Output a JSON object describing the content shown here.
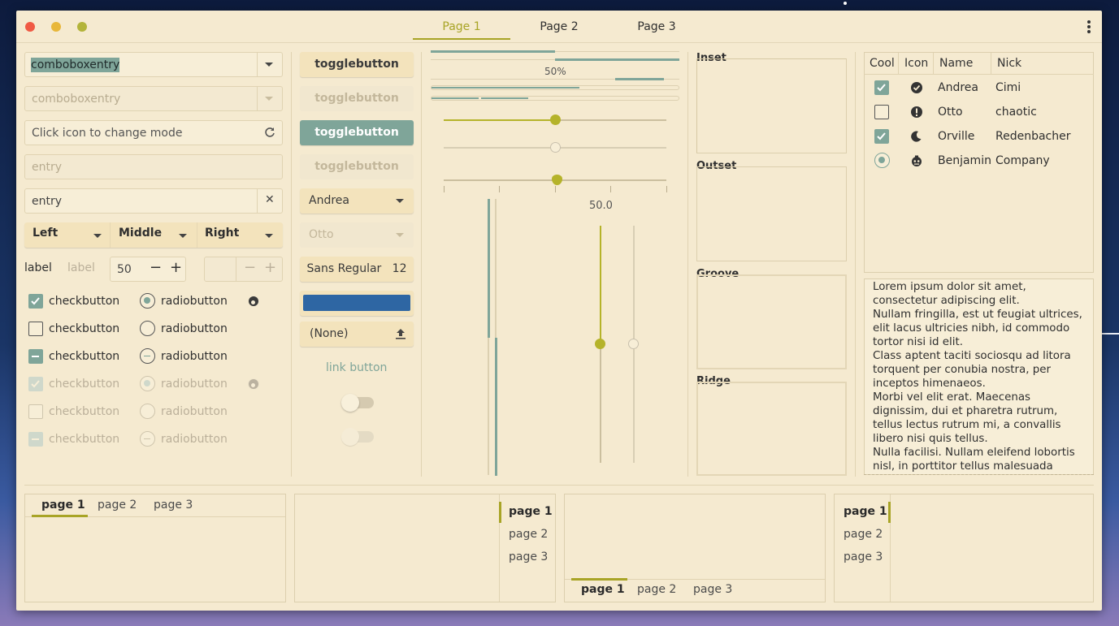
{
  "header": {
    "tabs": [
      {
        "label": "Page 1",
        "active": true
      },
      {
        "label": "Page 2",
        "active": false
      },
      {
        "label": "Page 3",
        "active": false
      }
    ]
  },
  "col1": {
    "combo1_value": "comboboxentry",
    "combo2_value": "comboboxentry",
    "mode_entry_placeholder": "Click icon to change mode",
    "entry_disabled_placeholder": "entry",
    "entry_value": "entry",
    "combo_left": "Left",
    "combo_middle": "Middle",
    "combo_right": "Right",
    "label": "label",
    "label_disabled": "label",
    "spin_value": "50",
    "checkbutton": "checkbutton",
    "radiobutton": "radiobutton"
  },
  "col2": {
    "toggle": "togglebutton",
    "combo_andrea": "Andrea",
    "combo_otto": "Otto",
    "font_name": "Sans Regular",
    "font_size": "12",
    "color_value": "#2e66a3",
    "file_chooser": "(None)",
    "link_button": "link button"
  },
  "col3": {
    "progress_label": "50%",
    "progress_fraction": 0.5,
    "scale_value_label": "50.0",
    "scale_value": 50
  },
  "frames": {
    "inset": "Inset",
    "outset": "Outset",
    "groove": "Groove",
    "ridge": "Ridge"
  },
  "treeview": {
    "columns": [
      "Cool",
      "Icon",
      "Name",
      "Nick"
    ],
    "rows": [
      {
        "cool": "checked",
        "icon": "check-circle-icon",
        "name": "Andrea",
        "nick": "Cimi"
      },
      {
        "cool": "unchecked",
        "icon": "warning-circle-icon",
        "name": "Otto",
        "nick": "chaotic"
      },
      {
        "cool": "checked",
        "icon": "moon-icon",
        "name": "Orville",
        "nick": "Redenbacher"
      },
      {
        "cool": "radio",
        "icon": "face-icon",
        "name": "Benjamin",
        "nick": "Company"
      }
    ]
  },
  "textview": {
    "text": "Lorem ipsum dolor sit amet, consectetur adipiscing elit.\nNullam fringilla, est ut feugiat ultrices, elit lacus ultricies nibh, id commodo tortor nisi id elit.\nClass aptent taciti sociosqu ad litora torquent per conubia nostra, per inceptos himenaeos.\nMorbi vel elit erat. Maecenas dignissim, dui et pharetra rutrum, tellus lectus rutrum mi, a convallis libero nisi quis tellus.\nNulla facilisi. Nullam eleifend lobortis nisl, in porttitor tellus malesuada"
  },
  "notebooks": {
    "tabs": [
      "page 1",
      "page 2",
      "page 3"
    ]
  },
  "colors": {
    "accent": "#a8a426",
    "toggle_checked": "#7fa599",
    "window_bg": "#f5ead0"
  }
}
